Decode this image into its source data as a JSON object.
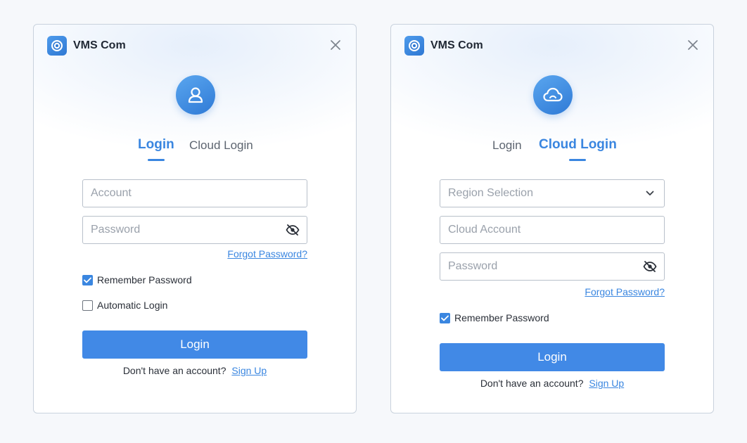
{
  "colors": {
    "accent": "#3a86e0",
    "button": "#4189e6",
    "border": "#b8c0ca"
  },
  "left": {
    "app_title": "VMS Com",
    "avatar_icon": "user-icon",
    "tabs": [
      {
        "label": "Login",
        "active": true
      },
      {
        "label": "Cloud Login",
        "active": false
      }
    ],
    "account_placeholder": "Account",
    "password_placeholder": "Password",
    "forgot_password": "Forgot Password?",
    "remember_password": {
      "label": "Remember Password",
      "checked": true
    },
    "automatic_login": {
      "label": "Automatic Login",
      "checked": false
    },
    "login_button": "Login",
    "no_account_text": "Don't have an account?",
    "sign_up": "Sign Up"
  },
  "right": {
    "app_title": "VMS Com",
    "avatar_icon": "cloud-icon",
    "tabs": [
      {
        "label": "Login",
        "active": false
      },
      {
        "label": "Cloud Login",
        "active": true
      }
    ],
    "region_placeholder": "Region Selection",
    "cloud_account_placeholder": "Cloud Account",
    "password_placeholder": "Password",
    "forgot_password": "Forgot Password?",
    "remember_password": {
      "label": "Remember Password",
      "checked": true
    },
    "login_button": "Login",
    "no_account_text": "Don't have an account?",
    "sign_up": "Sign Up"
  }
}
